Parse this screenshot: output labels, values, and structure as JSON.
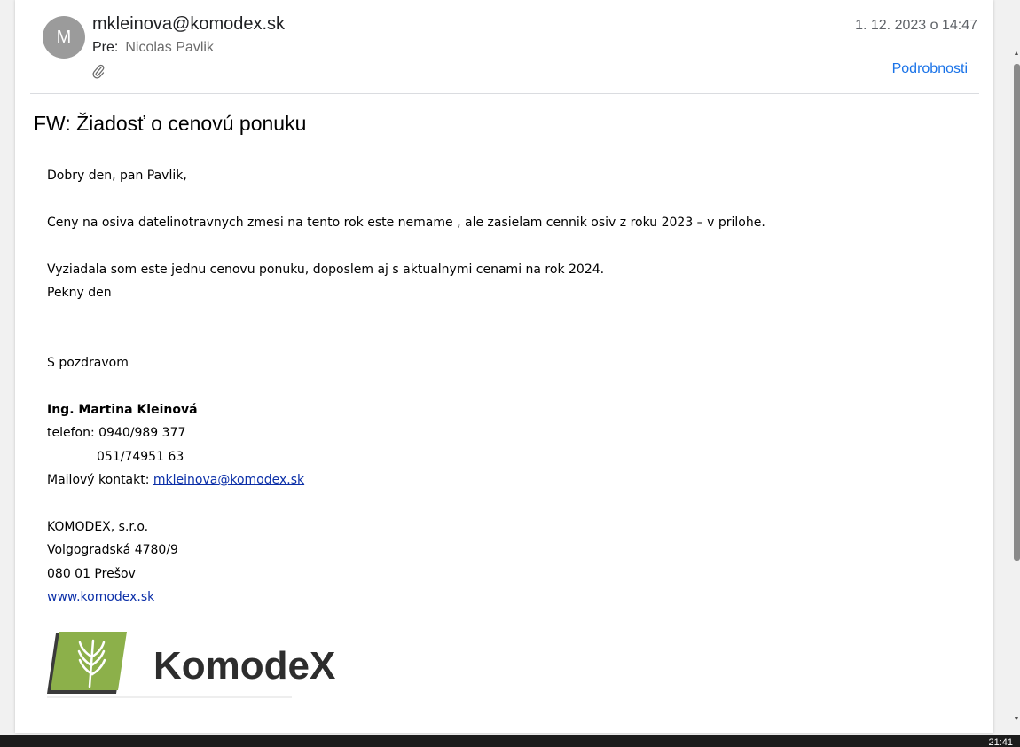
{
  "header": {
    "avatar_initial": "M",
    "sender": "mkleinova@komodex.sk",
    "to_label": "Pre:",
    "to_name": "Nicolas Pavlik",
    "date": "1. 12. 2023 o 14:47",
    "details_label": "Podrobnosti",
    "attachment_icon": "paperclip-icon"
  },
  "subject": "FW: Žiadosť o cenovú ponuku",
  "body": {
    "greeting": "Dobry den, pan Pavlik,",
    "p1": "Ceny na osiva datelinotravnych zmesi na tento rok este nemame , ale zasielam cennik osiv z roku 2023 – v prilohe.",
    "p2": "Vyziadala som este jednu cenovu ponuku, doposlem aj s aktualnymi cenami na rok 2024.",
    "p3": "Pekny den",
    "closing": "S pozdravom"
  },
  "signature": {
    "name": "Ing. Martina Kleinová",
    "phone1": "telefon: 0940/989 377",
    "phone2": "051/74951 63",
    "mail_label": "Mailový kontakt:",
    "mail_link": "mkleinova@komodex.sk",
    "company": "KOMODEX, s.r.o.",
    "street": "Volgogradská 4780/9",
    "city": "080 01 Prešov",
    "web": "www.komodex.sk",
    "logo_text": "KomodeX"
  },
  "taskbar": {
    "clock": "21:41"
  },
  "colors": {
    "accent": "#1a73e8",
    "link": "#0b2fa8",
    "avatar": "#9b9b9b",
    "logo_green": "#8cb04a"
  }
}
